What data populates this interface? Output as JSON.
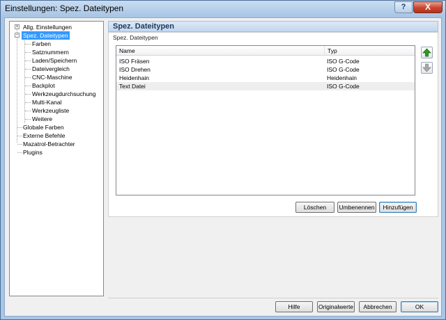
{
  "window": {
    "title": "Einstellungen: Spez. Dateitypen",
    "help_label": "?",
    "close_label": "X"
  },
  "tree": {
    "items": [
      {
        "label": "Allg. Einstellungen",
        "expander": "+"
      },
      {
        "label": "Spez. Dateitypen",
        "expander": "−",
        "selected": true
      },
      {
        "label": "Farben"
      },
      {
        "label": "Satznummern"
      },
      {
        "label": "Laden/Speichern"
      },
      {
        "label": "Dateivergleich"
      },
      {
        "label": "CNC-Maschine"
      },
      {
        "label": "Backplot"
      },
      {
        "label": "Werkzeugdurchsuchung"
      },
      {
        "label": "Multi-Kanal"
      },
      {
        "label": "Werkzeugliste"
      },
      {
        "label": "Weitere"
      },
      {
        "label": "Globale Farben"
      },
      {
        "label": "Externe Befehle"
      },
      {
        "label": "Mazatrol-Betrachter"
      },
      {
        "label": "Plugins"
      }
    ]
  },
  "panel": {
    "header": "Spez. Dateitypen",
    "group_title": "Spez. Dateitypen"
  },
  "list": {
    "columns": [
      "Name",
      "Typ"
    ],
    "rows": [
      {
        "name": "ISO Fräsen",
        "typ": "ISO G-Code"
      },
      {
        "name": "ISO Drehen",
        "typ": "ISO G-Code"
      },
      {
        "name": "Heidenhain",
        "typ": "Heidenhain"
      },
      {
        "name": "Text Datei",
        "typ": "ISO G-Code"
      }
    ]
  },
  "actions": {
    "delete": "Löschen",
    "rename": "Umbenennen",
    "add": "Hinzufügen"
  },
  "footer": {
    "help": "Hilfe",
    "defaults": "Originalwerte",
    "cancel": "Abbrechen",
    "ok": "OK"
  },
  "colors": {
    "accent": "#3399ff",
    "arrow_up": "#2e9e1a",
    "arrow_down_disabled": "#a8a8a8"
  },
  "icons": {
    "move_up": "green-up-arrow-icon",
    "move_down": "gray-down-arrow-icon"
  }
}
